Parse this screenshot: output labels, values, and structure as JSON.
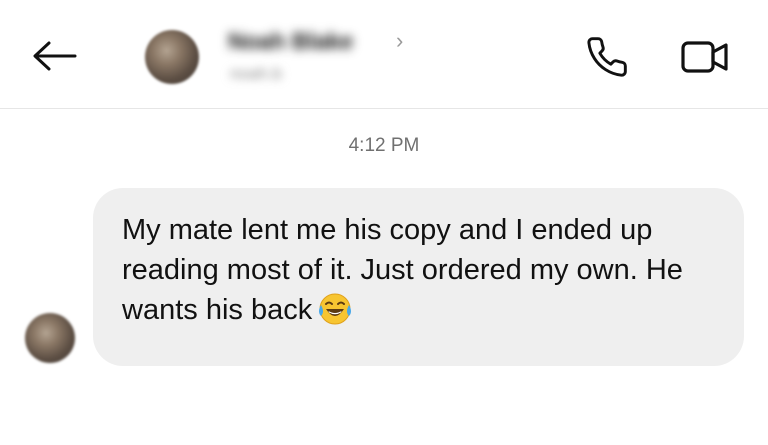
{
  "header": {
    "contact_name": "Noah Blake",
    "contact_handle": "noah.b",
    "chevron": "›",
    "icons": {
      "back": "arrow-left-icon",
      "call": "phone-icon",
      "video": "video-camera-icon"
    }
  },
  "conversation": {
    "timestamp": "4:12 PM",
    "messages": [
      {
        "sender": "contact",
        "text": "My mate lent me his copy and I ended up reading most of it. Just ordered my own. He wants his back",
        "emoji": "face-with-tears-of-joy"
      }
    ]
  }
}
